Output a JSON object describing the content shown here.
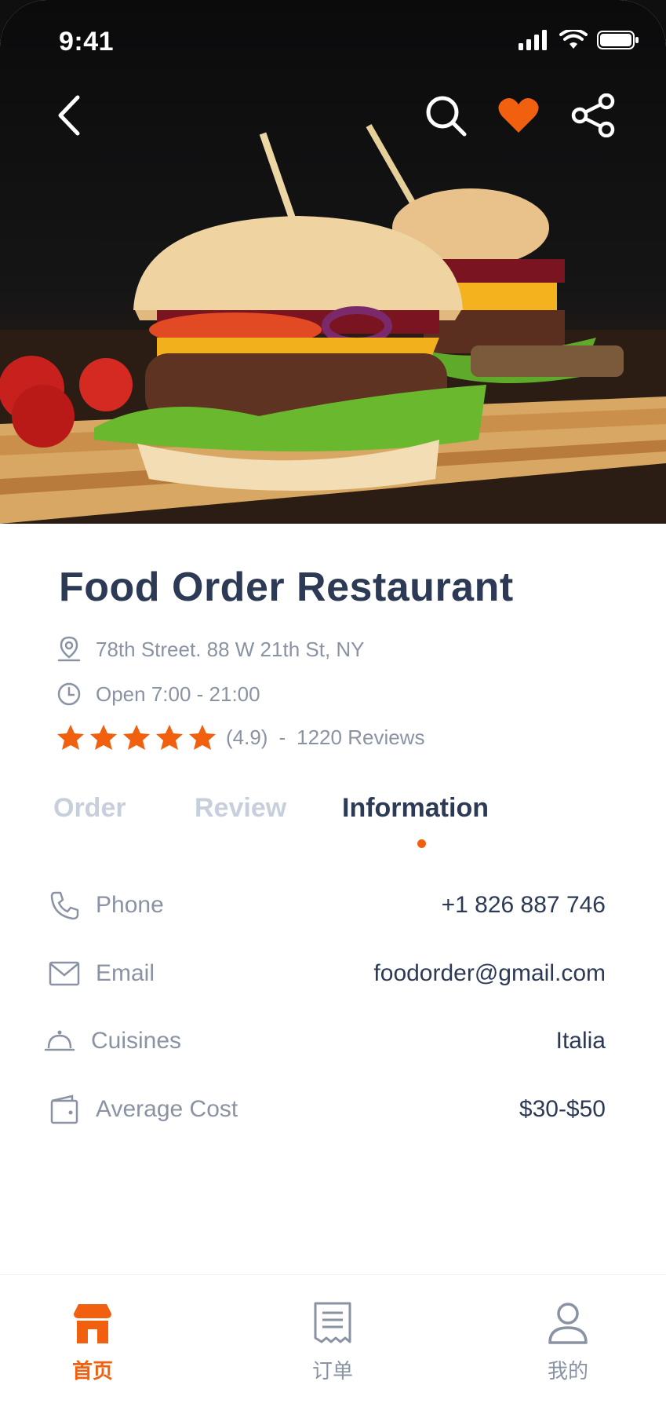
{
  "status_bar": {
    "time": "9:41"
  },
  "nav": {
    "back_icon": "chevron-left-icon",
    "search_icon": "search-icon",
    "favorite_icon": "heart-icon",
    "share_icon": "share-icon",
    "favorite_active": true
  },
  "restaurant": {
    "name": "Food Order Restaurant",
    "address": "78th Street. 88 W 21th St, NY",
    "hours": "Open 7:00 - 21:00",
    "rating": "(4.9)",
    "rating_value": 4.9,
    "separator": "-",
    "reviews": "1220 Reviews"
  },
  "tabs": [
    {
      "label": "Order",
      "active": false
    },
    {
      "label": "Review",
      "active": false
    },
    {
      "label": "Information",
      "active": true
    }
  ],
  "info": [
    {
      "icon": "phone-icon",
      "label": "Phone",
      "value": "+1 826 887 746"
    },
    {
      "icon": "mail-icon",
      "label": "Email",
      "value": "foodorder@gmail.com"
    },
    {
      "icon": "cloche-icon",
      "label": "Cuisines",
      "value": "Italia"
    },
    {
      "icon": "wallet-icon",
      "label": "Average Cost",
      "value": "$30-$50"
    }
  ],
  "bottom_nav": [
    {
      "label": "首页",
      "icon": "store-icon",
      "active": true
    },
    {
      "label": "订单",
      "icon": "receipt-icon",
      "active": false
    },
    {
      "label": "我的",
      "icon": "user-icon",
      "active": false
    }
  ],
  "colors": {
    "accent": "#f0600f",
    "title": "#2c3a55",
    "muted": "#8a93a3",
    "tab_inactive": "#c7cfdb"
  }
}
